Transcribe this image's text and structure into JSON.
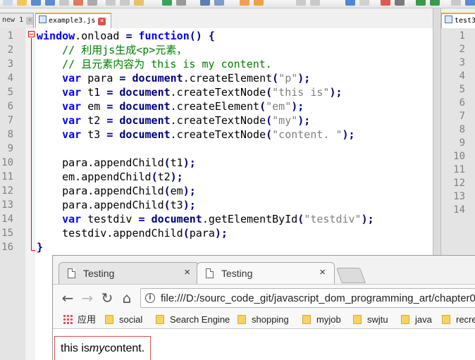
{
  "editor": {
    "tabs": [
      {
        "label": "new 1"
      },
      {
        "label": "example3.js"
      },
      {
        "label": "test3"
      }
    ],
    "code_lines": [
      {
        "num": "1",
        "html": "<span class=\"kw\">window</span>.onload <span class=\"op\">=</span> <span class=\"kw\">function</span><span class=\"op\">()</span> <span class=\"op\">{</span>"
      },
      {
        "num": "2",
        "html": "    <span class=\"cmt\">// 利用js生成&lt;p&gt;元素，</span>"
      },
      {
        "num": "3",
        "html": "    <span class=\"cmt\">// 且元素内容为 this is my content.</span>"
      },
      {
        "num": "4",
        "html": "    <span class=\"kw\">var</span> para <span class=\"op\">=</span> <span class=\"kw2\">document</span>.createElement<span class=\"op\">(</span><span class=\"str\">\"p\"</span><span class=\"op\">);</span>"
      },
      {
        "num": "5",
        "html": "    <span class=\"kw\">var</span> t1 <span class=\"op\">=</span> <span class=\"kw2\">document</span>.createTextNode<span class=\"op\">(</span><span class=\"str\">\"this is\"</span><span class=\"op\">);</span>"
      },
      {
        "num": "6",
        "html": "    <span class=\"kw\">var</span> em <span class=\"op\">=</span> <span class=\"kw2\">document</span>.createElement<span class=\"op\">(</span><span class=\"str\">\"em\"</span><span class=\"op\">);</span>"
      },
      {
        "num": "7",
        "html": "    <span class=\"kw\">var</span> t2 <span class=\"op\">=</span> <span class=\"kw2\">document</span>.createTextNode<span class=\"op\">(</span><span class=\"str\">\"my\"</span><span class=\"op\">);</span>"
      },
      {
        "num": "8",
        "html": "    <span class=\"kw\">var</span> t3 <span class=\"op\">=</span> <span class=\"kw2\">document</span>.createTextNode<span class=\"op\">(</span><span class=\"str\">\"content. \"</span><span class=\"op\">);</span>"
      },
      {
        "num": "9",
        "html": ""
      },
      {
        "num": "10",
        "html": "    para.appendChild<span class=\"op\">(</span>t1<span class=\"op\">);</span>"
      },
      {
        "num": "11",
        "html": "    em.appendChild<span class=\"op\">(</span>t2<span class=\"op\">);</span>"
      },
      {
        "num": "12",
        "html": "    para.appendChild<span class=\"op\">(</span>em<span class=\"op\">);</span>"
      },
      {
        "num": "13",
        "html": "    para.appendChild<span class=\"op\">(</span>t3<span class=\"op\">);</span>"
      },
      {
        "num": "14",
        "html": "    <span class=\"kw\">var</span> testdiv <span class=\"op\">=</span> <span class=\"kw2\">document</span>.getElementById<span class=\"op\">(</span><span class=\"str\">\"testdiv\"</span><span class=\"op\">);</span>"
      },
      {
        "num": "15",
        "html": "    testdiv.appendChild<span class=\"op\">(</span>para<span class=\"op\">);</span>"
      },
      {
        "num": "16",
        "html": "<span class=\"op\">}</span>"
      }
    ],
    "right_pane_line_numbers": [
      "1",
      "2",
      "3",
      "4",
      "5",
      "6",
      "7",
      "8",
      "9",
      "10",
      "11",
      "12",
      "13",
      "14"
    ]
  },
  "browser": {
    "tabs": [
      {
        "title": "Testing",
        "close": "×"
      },
      {
        "title": "Testing",
        "close": "×"
      }
    ],
    "nav": {
      "back": "←",
      "forward": "→",
      "reload": "↻",
      "home": "⌂"
    },
    "address": "file:///D:/sourc_code_git/javascript_dom_programming_art/chapter0",
    "bookmarks": [
      {
        "label": "应用"
      },
      {
        "label": "social"
      },
      {
        "label": "Search Engine"
      },
      {
        "label": "shopping"
      },
      {
        "label": "myjob"
      },
      {
        "label": "swjtu"
      },
      {
        "label": "java"
      },
      {
        "label": "recre"
      }
    ],
    "page_content": {
      "before": "this is",
      "em": "my",
      "after": "content."
    }
  }
}
